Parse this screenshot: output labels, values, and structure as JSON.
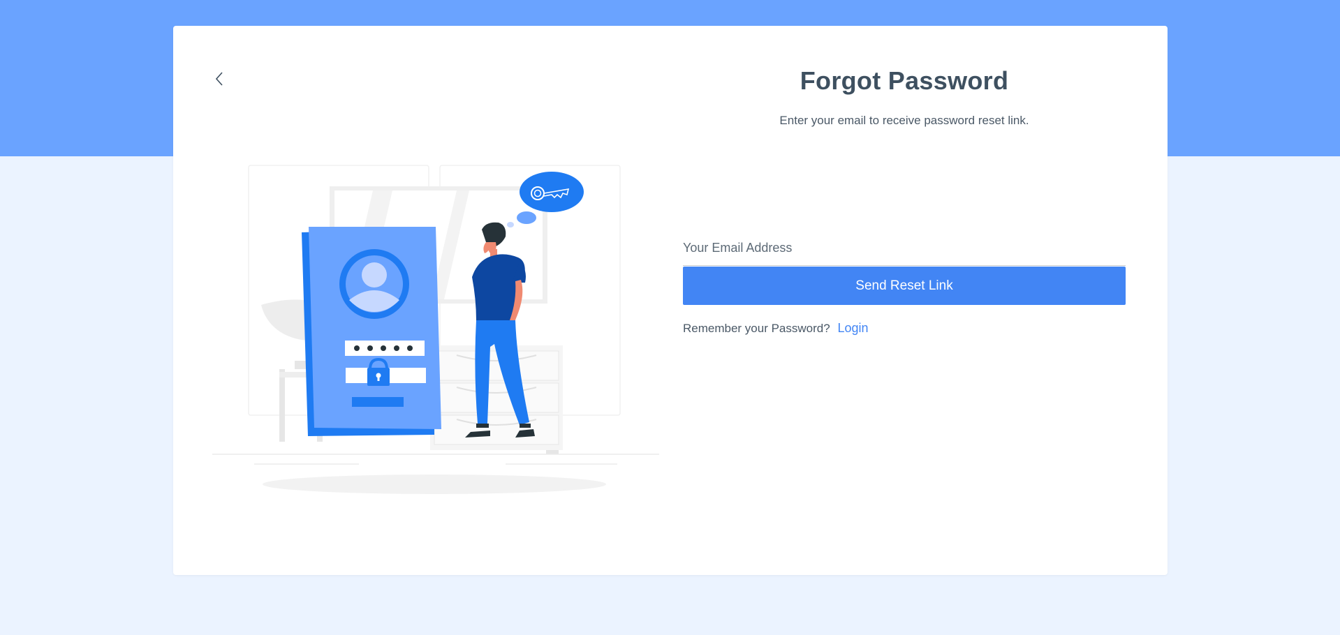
{
  "page": {
    "title": "Forgot Password",
    "subtitle": "Enter your email to receive password reset link."
  },
  "form": {
    "email_placeholder": "Your Email Address",
    "email_value": "",
    "submit_label": "Send Reset Link"
  },
  "footer": {
    "remember_text": "Remember your Password?",
    "login_label": "Login"
  },
  "icons": {
    "back": "chevron-left-icon",
    "illustration": "forgot-password-illustration"
  },
  "colors": {
    "header_band": "#6aa3ff",
    "page_background": "#ebf3ff",
    "accent": "#4285f4",
    "title_text": "#3e5060"
  }
}
